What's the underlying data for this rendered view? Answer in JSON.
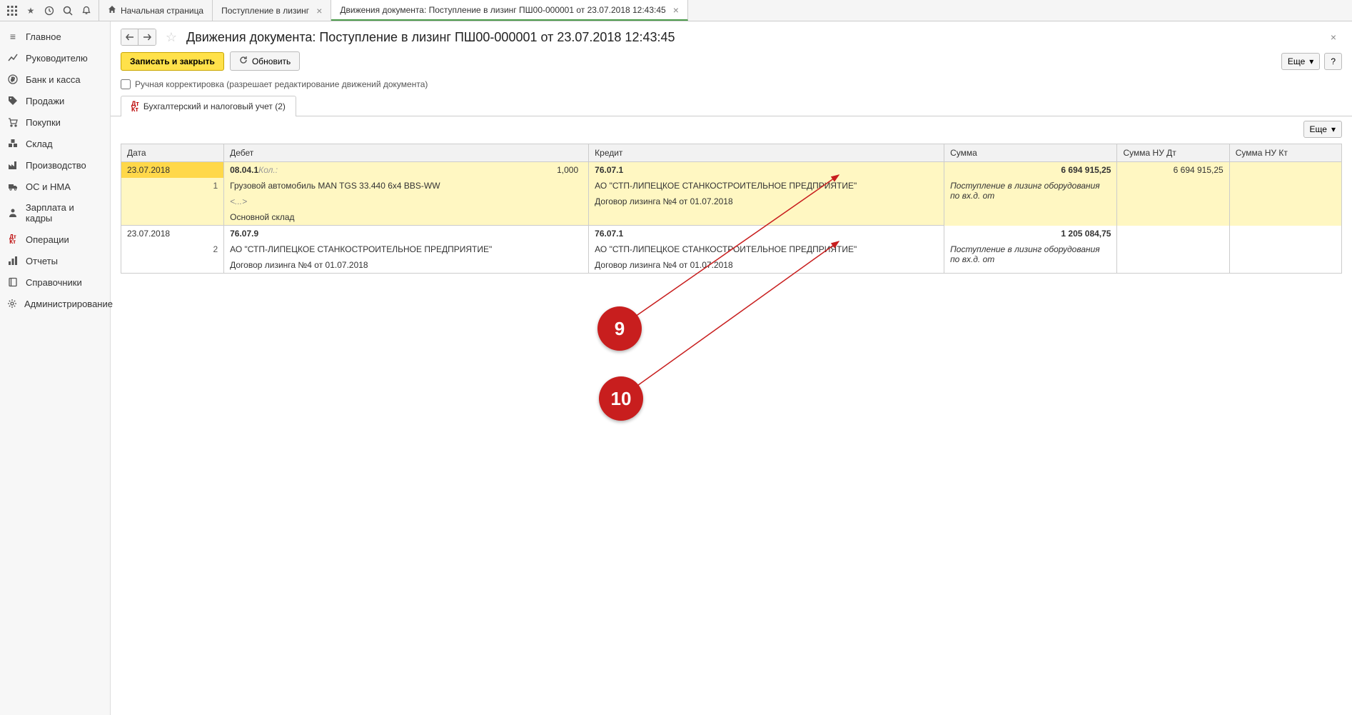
{
  "toolbar_icons": [
    "apps",
    "star",
    "pin",
    "search",
    "bell"
  ],
  "tabs": [
    {
      "label": "Начальная страница",
      "icon": "home",
      "closable": false
    },
    {
      "label": "Поступление в лизинг",
      "closable": true
    },
    {
      "label": "Движения документа: Поступление в лизинг ПШ00-000001 от 23.07.2018 12:43:45",
      "closable": true,
      "active": true
    }
  ],
  "sidebar": {
    "items": [
      {
        "label": "Главное",
        "icon": "menu"
      },
      {
        "label": "Руководителю",
        "icon": "trend"
      },
      {
        "label": "Банк и касса",
        "icon": "ruble"
      },
      {
        "label": "Продажи",
        "icon": "tag"
      },
      {
        "label": "Покупки",
        "icon": "cart"
      },
      {
        "label": "Склад",
        "icon": "boxes"
      },
      {
        "label": "Производство",
        "icon": "factory"
      },
      {
        "label": "ОС и НМА",
        "icon": "truck"
      },
      {
        "label": "Зарплата и кадры",
        "icon": "person"
      },
      {
        "label": "Операции",
        "icon": "dtkt"
      },
      {
        "label": "Отчеты",
        "icon": "chart"
      },
      {
        "label": "Справочники",
        "icon": "book"
      },
      {
        "label": "Администрирование",
        "icon": "gear"
      }
    ]
  },
  "page": {
    "title": "Движения документа: Поступление в лизинг ПШ00-000001 от 23.07.2018 12:43:45",
    "save_close_label": "Записать и закрыть",
    "refresh_label": "Обновить",
    "more_label": "Еще",
    "help_label": "?",
    "manual_adjust_label": "Ручная корректировка (разрешает редактирование движений документа)",
    "subtab_label": "Бухгалтерский и налоговый учет (2)"
  },
  "table": {
    "headers": {
      "date": "Дата",
      "debit": "Дебет",
      "credit": "Кредит",
      "sum": "Сумма",
      "nu_dt": "Сумма НУ Дт",
      "nu_kt": "Сумма НУ Кт"
    },
    "qty_label": "Кол.:",
    "rows": [
      {
        "date": "23.07.2018",
        "n": "1",
        "debit_acc": "08.04.1",
        "qty": "1,000",
        "debit_lines": [
          "Грузовой автомобиль MAN TGS 33.440 6x4 BBS-WW",
          "<...>",
          "Основной склад"
        ],
        "credit_acc": "76.07.1",
        "credit_lines": [
          "АО \"СТП-ЛИПЕЦКОЕ СТАНКОСТРОИТЕЛЬНОЕ ПРЕДПРИЯТИЕ\"",
          "Договор лизинга №4 от 01.07.2018"
        ],
        "sum": "6 694 915,25",
        "desc": "Поступление в лизинг оборудования по вх.д.  от",
        "nu_dt": "6 694 915,25",
        "nu_kt": "",
        "selected": true
      },
      {
        "date": "23.07.2018",
        "n": "2",
        "debit_acc": "76.07.9",
        "qty": "",
        "debit_lines": [
          "АО \"СТП-ЛИПЕЦКОЕ СТАНКОСТРОИТЕЛЬНОЕ ПРЕДПРИЯТИЕ\"",
          "Договор лизинга №4 от 01.07.2018"
        ],
        "credit_acc": "76.07.1",
        "credit_lines": [
          "АО \"СТП-ЛИПЕЦКОЕ СТАНКОСТРОИТЕЛЬНОЕ ПРЕДПРИЯТИЕ\"",
          "Договор лизинга №4 от 01.07.2018"
        ],
        "sum": "1 205 084,75",
        "desc": "Поступление в лизинг оборудования по вх.д.  от",
        "nu_dt": "",
        "nu_kt": "",
        "selected": false
      }
    ]
  },
  "annotations": {
    "a": {
      "label": "9"
    },
    "b": {
      "label": "10"
    }
  }
}
